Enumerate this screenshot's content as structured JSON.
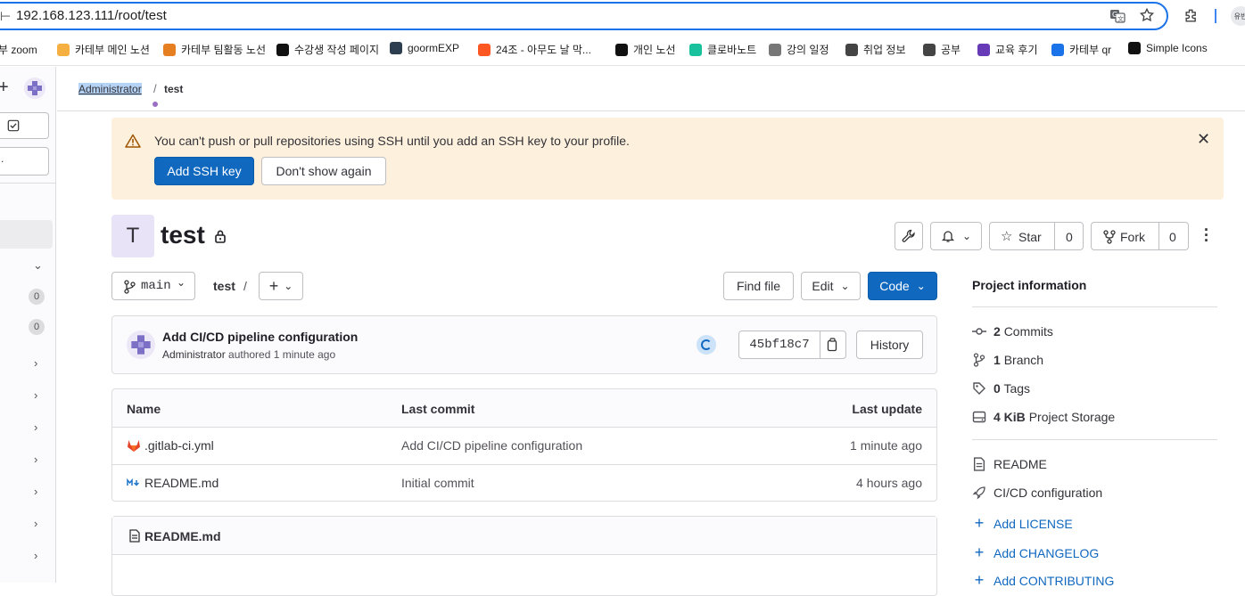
{
  "browser": {
    "url": "192.168.123.111/root/test",
    "bookmarks": [
      {
        "label": "부 zoom",
        "icon": "zoom-icon",
        "color": "#2d8cff"
      },
      {
        "label": "카테부 메인 노션",
        "icon": "emoji-icon",
        "color": "#f5b041"
      },
      {
        "label": "카테부 팀활동 노선",
        "icon": "bookmark-page-icon",
        "color": "#e67e22"
      },
      {
        "label": "수강생 작성 페이지",
        "icon": "notion-icon",
        "color": "#111111"
      },
      {
        "label": "goormEXP",
        "icon": "monitor-icon",
        "color": "#2c3e50"
      },
      {
        "label": "24조 - 아무도 날 막...",
        "icon": "fire-icon",
        "color": "#ff5722"
      },
      {
        "label": "개인 노선",
        "icon": "notion-icon",
        "color": "#111111"
      },
      {
        "label": "클로바노트",
        "icon": "clova-icon",
        "color": "#19c29c"
      },
      {
        "label": "강의 일정",
        "icon": "calendar-icon",
        "color": "#777777"
      },
      {
        "label": "취업 정보",
        "icon": "folder-icon",
        "color": "#444444"
      },
      {
        "label": "공부",
        "icon": "folder-icon",
        "color": "#444444"
      },
      {
        "label": "교육 후기",
        "icon": "form-icon",
        "color": "#673ab7"
      },
      {
        "label": "카테부 qr",
        "icon": "qr-icon",
        "color": "#1a73e8"
      },
      {
        "label": "Simple Icons",
        "icon": "simpleicons-icon",
        "color": "#111111"
      }
    ]
  },
  "sidebar": {
    "badges": [
      "0",
      "0"
    ]
  },
  "breadcrumb": {
    "owner": "Administrator",
    "separator": "/",
    "project": "test"
  },
  "alert": {
    "message": "You can't push or pull repositories using SSH until you add an SSH key to your profile.",
    "primary_button": "Add SSH key",
    "secondary_button": "Don't show again"
  },
  "project": {
    "avatar_letter": "T",
    "name": "test",
    "star_label": "Star",
    "star_count": "0",
    "fork_label": "Fork",
    "fork_count": "0"
  },
  "repo_toolbar": {
    "branch": "main",
    "path_root": "test",
    "path_sep": "/",
    "find_file": "Find file",
    "edit": "Edit",
    "code": "Code"
  },
  "last_commit": {
    "title": "Add CI/CD pipeline configuration",
    "author": "Administrator",
    "authored_text": "authored",
    "time": "1 minute ago",
    "sha": "45bf18c7",
    "history": "History"
  },
  "files": {
    "headers": [
      "Name",
      "Last commit",
      "Last update"
    ],
    "rows": [
      {
        "name": ".gitlab-ci.yml",
        "icon": "gitlab-icon",
        "commit": "Add CI/CD pipeline configuration",
        "updated": "1 minute ago"
      },
      {
        "name": "README.md",
        "icon": "markdown-icon",
        "commit": "Initial commit",
        "updated": "4 hours ago"
      }
    ]
  },
  "readme": {
    "title": "README.md"
  },
  "project_info": {
    "heading": "Project information",
    "commits_count": "2",
    "commits_label": "Commits",
    "branch_count": "1",
    "branch_label": "Branch",
    "tags_count": "0",
    "tags_label": "Tags",
    "storage_size": "4 KiB",
    "storage_label": "Project Storage",
    "links": [
      "README",
      "CI/CD configuration"
    ],
    "adds": [
      "Add LICENSE",
      "Add CHANGELOG",
      "Add CONTRIBUTING"
    ]
  },
  "colors": {
    "primary": "#1068bf",
    "alert_bg": "#fdf1dd",
    "avatar_bg": "#e9e3f7"
  }
}
